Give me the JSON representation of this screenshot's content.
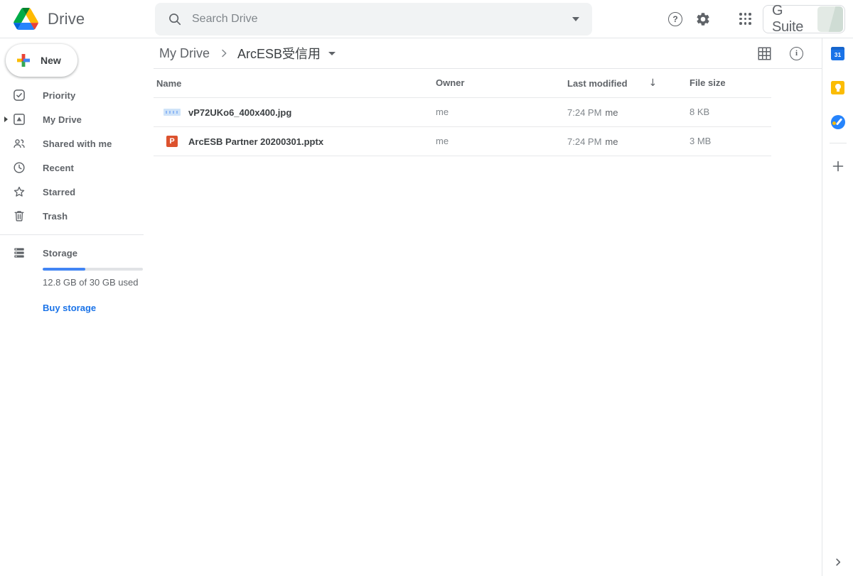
{
  "topbar": {
    "app_name": "Drive",
    "search": {
      "placeholder": "Search Drive"
    },
    "help_glyph": "?",
    "gsuite_label": "G Suite"
  },
  "sidebar": {
    "new_label": "New",
    "items": [
      {
        "label": "Priority"
      },
      {
        "label": "My Drive"
      },
      {
        "label": "Shared with me"
      },
      {
        "label": "Recent"
      },
      {
        "label": "Starred"
      },
      {
        "label": "Trash"
      }
    ],
    "storage": {
      "label": "Storage",
      "used_text": "12.8 GB of 30 GB used",
      "buy_label": "Buy storage",
      "percent_used": 42.7
    }
  },
  "breadcrumb": {
    "root": "My Drive",
    "current": "ArcESB受信用"
  },
  "table": {
    "headers": {
      "name": "Name",
      "owner": "Owner",
      "modified": "Last modified",
      "size": "File size"
    },
    "sort_glyph": "↓",
    "rows": [
      {
        "icon": "image-thumbnail",
        "name": "vP72UKo6_400x400.jpg",
        "owner": "me",
        "modified_time": "7:24 PM",
        "modified_by": "me",
        "size": "8 KB"
      },
      {
        "icon": "powerpoint",
        "pptx_letter": "P",
        "name": "ArcESB Partner 20200301.pptx",
        "owner": "me",
        "modified_time": "7:24 PM",
        "modified_by": "me",
        "size": "3 MB"
      }
    ]
  },
  "right_rail": {
    "calendar_day": "31"
  },
  "colors": {
    "link_blue": "#1a73e8",
    "progress_blue": "#4285f4",
    "pptx_orange": "#dc522e",
    "keep_yellow": "#fbbc04",
    "tasks_blue": "#2684fc",
    "calendar_blue": "#1a73e8",
    "text_gray": "#5f6368",
    "muted_gray": "#80868b"
  }
}
